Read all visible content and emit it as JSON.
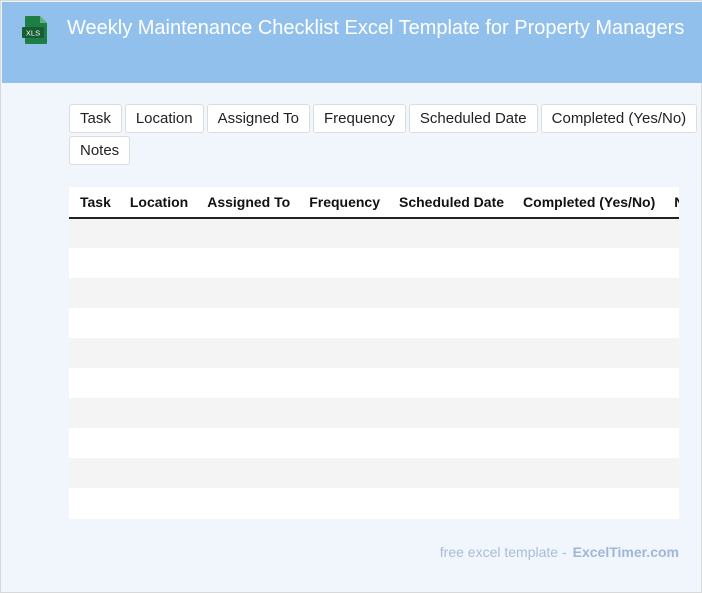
{
  "header": {
    "icon_label": "XLS",
    "title": "Weekly Maintenance Checklist Excel Template for Property Managers"
  },
  "chips": [
    "Task",
    "Location",
    "Assigned To",
    "Frequency",
    "Scheduled Date",
    "Completed (Yes/No)",
    "Notes"
  ],
  "table": {
    "columns": [
      "Task",
      "Location",
      "Assigned To",
      "Frequency",
      "Scheduled Date",
      "Completed (Yes/No)",
      "Notes"
    ],
    "row_count": 10
  },
  "footer": {
    "text": "free excel template -",
    "brand": "ExcelTimer.com"
  },
  "colors": {
    "header_bg": "#92c0ec",
    "page_bg": "#f1f6fd",
    "xls_green": "#1e7e45"
  }
}
